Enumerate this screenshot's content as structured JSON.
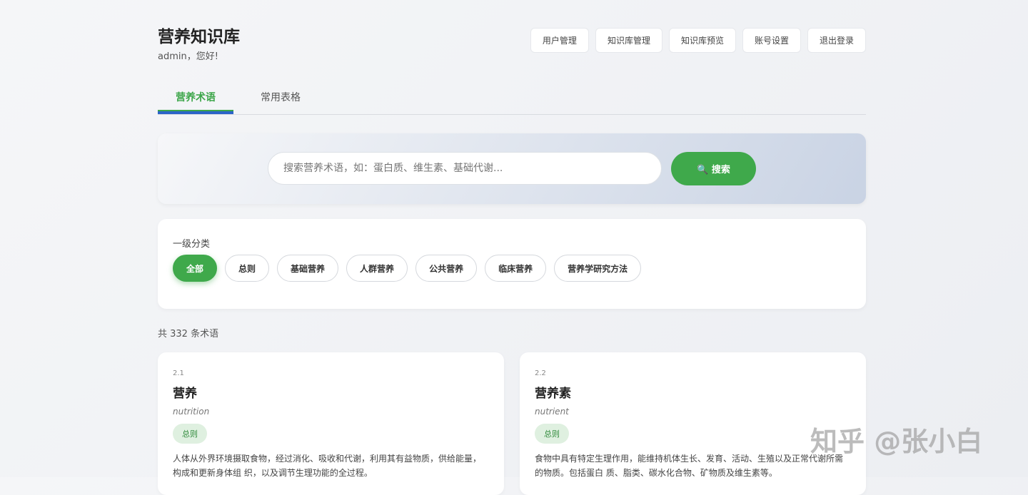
{
  "header": {
    "title": "营养知识库",
    "greeting": "admin，您好!",
    "nav": [
      "用户管理",
      "知识库管理",
      "知识库预览",
      "账号设置",
      "退出登录"
    ]
  },
  "tabs": [
    "营养术语",
    "常用表格"
  ],
  "search": {
    "placeholder": "搜索营养术语，如：蛋白质、维生素、基础代谢...",
    "icon": "🔍",
    "button": "搜索"
  },
  "filter": {
    "label": "一级分类",
    "chips": [
      "全部",
      "总则",
      "基础营养",
      "人群营养",
      "公共营养",
      "临床营养",
      "营养学研究方法"
    ]
  },
  "count": "共 332 条术语",
  "cards": [
    {
      "num": "2.1",
      "term": "营养",
      "en": "nutrition",
      "badge": "总则",
      "desc": "人体从外界环境摄取食物，经过消化、吸收和代谢，利用其有益物质，供给能量，构成和更新身体组 织，以及调节生理功能的全过程。"
    },
    {
      "num": "2.2",
      "term": "营养素",
      "en": "nutrient",
      "badge": "总则",
      "desc": "食物中具有特定生理作用，能维持机体生长、发育、活动、生殖以及正常代谢所需的物质。包括蛋白 质、脂类、碳水化合物、矿物质及维生素等。"
    }
  ],
  "watermark": "知乎 @张小白"
}
